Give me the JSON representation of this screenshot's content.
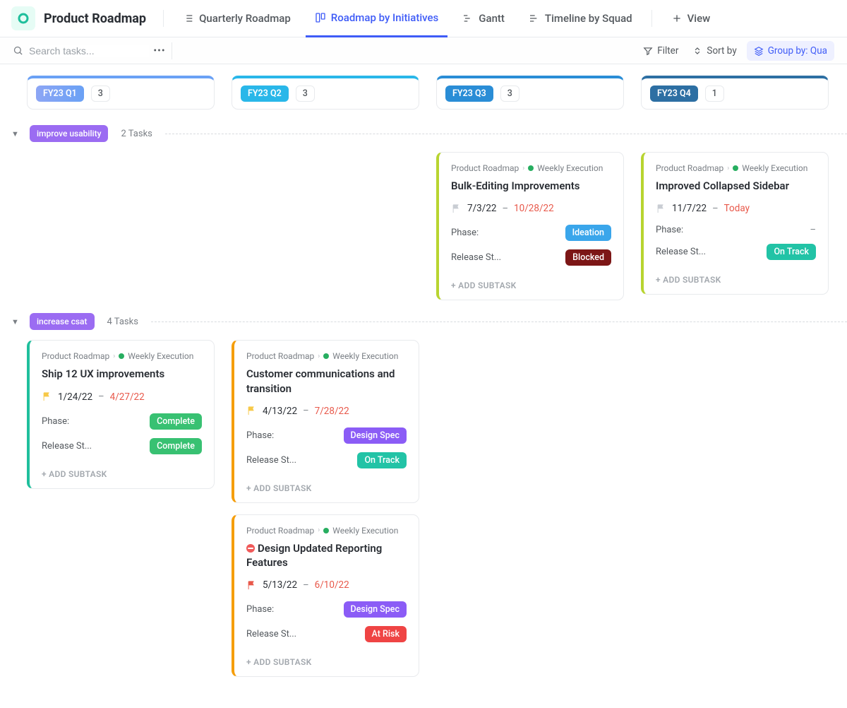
{
  "header": {
    "title": "Product Roadmap",
    "tabs": [
      {
        "label": "Quarterly Roadmap"
      },
      {
        "label": "Roadmap by Initiatives"
      },
      {
        "label": "Gantt"
      },
      {
        "label": "Timeline by Squad"
      }
    ],
    "addView": "View"
  },
  "toolbar": {
    "searchPlaceholder": "Search tasks...",
    "filter": "Filter",
    "sort": "Sort by",
    "group": "Group by: Qua"
  },
  "columns": [
    {
      "label": "FY23 Q1",
      "count": "3",
      "color": "#6aa1f5",
      "pill": "linear-gradient(90deg,#8da6f5,#6aa1f5)"
    },
    {
      "label": "FY23 Q2",
      "count": "3",
      "color": "#29b7e9",
      "pill": "#29b7e9"
    },
    {
      "label": "FY23 Q3",
      "count": "3",
      "color": "#2a8dd6",
      "pill": "#2a8dd6"
    },
    {
      "label": "FY23 Q4",
      "count": "1",
      "color": "#2d6fa3",
      "pill": "#2d6fa3"
    }
  ],
  "groups": [
    {
      "name": "improve usability",
      "color": "#9b6cf2",
      "taskCount": "2 Tasks",
      "rows": [
        [
          null,
          null,
          {
            "border": "#b8d430",
            "crumb1": "Product Roadmap",
            "crumb2": "Weekly Execution",
            "title": "Bulk-Editing Improvements",
            "flag": "#c9cdd3",
            "start": "7/3/22",
            "end": "10/28/22",
            "phaseLabel": "Phase:",
            "phase": {
              "text": "Ideation",
              "bg": "#3aa6eb"
            },
            "relLabel": "Release St...",
            "rel": {
              "text": "Blocked",
              "bg": "#7c1616"
            },
            "add": "+ ADD SUBTASK"
          },
          {
            "border": "#b8d430",
            "crumb1": "Product Roadmap",
            "crumb2": "Weekly Execution",
            "title": "Improved Collapsed Sidebar",
            "flag": "#c9cdd3",
            "start": "11/7/22",
            "end": "Today",
            "phaseLabel": "Phase:",
            "phaseEmpty": "–",
            "relLabel": "Release St...",
            "rel": {
              "text": "On Track",
              "bg": "#22c3a6"
            },
            "add": "+ ADD SUBTASK"
          }
        ]
      ]
    },
    {
      "name": "increase csat",
      "color": "#9b6cf2",
      "taskCount": "4 Tasks",
      "rows": [
        [
          {
            "border": "#1fbf9c",
            "crumb1": "Product Roadmap",
            "crumb2": "Weekly Execution",
            "title": "Ship 12 UX improvements",
            "flag": "#f7c948",
            "start": "1/24/22",
            "end": "4/27/22",
            "phaseLabel": "Phase:",
            "phase": {
              "text": "Complete",
              "bg": "#38c172"
            },
            "relLabel": "Release St...",
            "rel": {
              "text": "Complete",
              "bg": "#38c172"
            },
            "add": "+ ADD SUBTASK"
          },
          {
            "border": "#f59e0b",
            "crumb1": "Product Roadmap",
            "crumb2": "Weekly Execution",
            "title": "Customer communications and tran­sition",
            "flag": "#f7c948",
            "start": "4/13/22",
            "end": "7/28/22",
            "phaseLabel": "Phase:",
            "phase": {
              "text": "Design Spec",
              "bg": "#8b5cf6"
            },
            "relLabel": "Release St...",
            "rel": {
              "text": "On Track",
              "bg": "#22c3a6"
            },
            "add": "+ ADD SUBTASK"
          },
          null,
          null
        ],
        [
          null,
          {
            "border": "#f59e0b",
            "crumb1": "Product Roadmap",
            "crumb2": "Weekly Execution",
            "title": "Design Updated Reporting Features",
            "blocked": true,
            "flag": "#e8584a",
            "start": "5/13/22",
            "end": "6/10/22",
            "phaseLabel": "Phase:",
            "phase": {
              "text": "Design Spec",
              "bg": "#8b5cf6"
            },
            "relLabel": "Release St...",
            "rel": {
              "text": "At Risk",
              "bg": "#ef4444"
            },
            "add": "+ ADD SUBTASK"
          },
          null,
          null
        ]
      ]
    }
  ]
}
